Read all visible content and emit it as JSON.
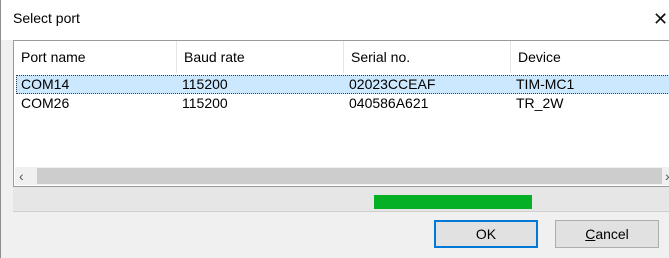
{
  "window": {
    "title": "Select port",
    "close_glyph": "✕"
  },
  "table": {
    "columns": [
      "Port name",
      "Baud rate",
      "Serial no.",
      "Device"
    ],
    "rows": [
      {
        "port": "COM14",
        "baud": "115200",
        "serial": "02023CCEAF",
        "device": "TIM-MC1",
        "selected": true
      },
      {
        "port": "COM26",
        "baud": "115200",
        "serial": "040586A621",
        "device": "TR_2W",
        "selected": false
      }
    ]
  },
  "scrollbar": {
    "left_arrow": "‹",
    "right_arrow": "›"
  },
  "progress": {
    "start_fraction": 0.55,
    "end_fraction": 0.79,
    "color": "#06b025"
  },
  "buttons": {
    "ok_label": "OK",
    "cancel_mnemonic": "C",
    "cancel_rest": "ancel"
  },
  "colors": {
    "selection": "#cce8ff",
    "default_button_border": "#0078d7"
  }
}
